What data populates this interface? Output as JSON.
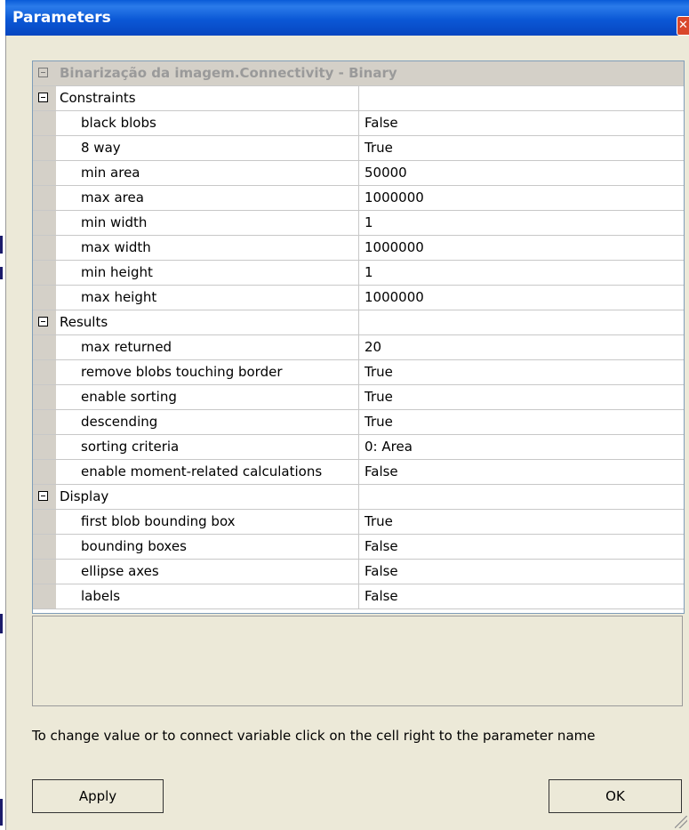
{
  "window": {
    "title": "Parameters",
    "close_glyph": "✕"
  },
  "grid": {
    "header": "Binarização da imagem.Connectivity - Binary",
    "categories": [
      {
        "label": "Constraints",
        "items": [
          {
            "name": "black blobs",
            "value": "False"
          },
          {
            "name": "8 way",
            "value": "True"
          },
          {
            "name": "min area",
            "value": "50000"
          },
          {
            "name": "max area",
            "value": "1000000"
          },
          {
            "name": "min width",
            "value": "1"
          },
          {
            "name": "max width",
            "value": "1000000"
          },
          {
            "name": "min height",
            "value": "1"
          },
          {
            "name": "max height",
            "value": "1000000"
          }
        ]
      },
      {
        "label": "Results",
        "items": [
          {
            "name": "max returned",
            "value": "20"
          },
          {
            "name": "remove blobs touching border",
            "value": "True"
          },
          {
            "name": "enable sorting",
            "value": "True"
          },
          {
            "name": "descending",
            "value": "True"
          },
          {
            "name": "sorting criteria",
            "value": "0: Area"
          },
          {
            "name": "enable moment-related calculations",
            "value": "False"
          }
        ]
      },
      {
        "label": "Display",
        "items": [
          {
            "name": "first blob bounding box",
            "value": "True"
          },
          {
            "name": "bounding boxes",
            "value": "False"
          },
          {
            "name": "ellipse axes",
            "value": "False"
          },
          {
            "name": "labels",
            "value": "False"
          }
        ]
      }
    ]
  },
  "hint": "To change value or to connect variable click on the cell right to the parameter name",
  "buttons": {
    "apply": "Apply",
    "ok": "OK"
  },
  "icons": {
    "expander": "collapse-minus-icon",
    "close": "close-icon"
  }
}
